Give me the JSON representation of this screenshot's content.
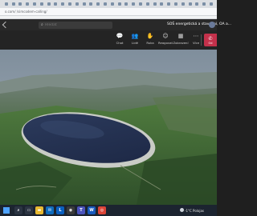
{
  "browser": {
    "url": "o.com/ /simcodem-calling/",
    "tab_count": 32
  },
  "teams": {
    "search_placeholder": "Hledat",
    "meeting_title": "SOŠ energetická a stavební, OA a..."
  },
  "toolbar": {
    "items": [
      {
        "label": "Chat",
        "icon": "chat-icon",
        "glyph": "💬"
      },
      {
        "label": "Lidé",
        "icon": "people-icon",
        "glyph": "👥"
      },
      {
        "label": "Ruka",
        "icon": "raise-hand-icon",
        "glyph": "✋"
      },
      {
        "label": "Reagovat",
        "icon": "react-icon",
        "glyph": "☺"
      },
      {
        "label": "Zobrazení",
        "icon": "view-icon",
        "glyph": "▦"
      },
      {
        "label": "Více",
        "icon": "more-icon",
        "glyph": "⋯"
      }
    ],
    "leave_label": "Od"
  },
  "taskbar": {
    "apps": [
      {
        "name": "search",
        "color": "#2b3442",
        "glyph": "⌕"
      },
      {
        "name": "task-view",
        "color": "#2b3442",
        "glyph": "▭"
      },
      {
        "name": "file-explorer",
        "color": "#e8b931",
        "glyph": "▬"
      },
      {
        "name": "mail",
        "color": "#0f6cbd",
        "glyph": "✉"
      },
      {
        "name": "lenovo",
        "color": "#0a5fbf",
        "glyph": "L"
      },
      {
        "name": "app-camera",
        "color": "#3a3a3a",
        "glyph": "◉"
      },
      {
        "name": "teams",
        "color": "#4b53bc",
        "glyph": "T"
      },
      {
        "name": "word",
        "color": "#185abd",
        "glyph": "W"
      },
      {
        "name": "chrome",
        "color": "#db4437",
        "glyph": "◎"
      }
    ],
    "weather": "-1°C Polojas"
  },
  "colors": {
    "leave": "#c4314b",
    "header": "#292929",
    "toolbar": "#242424",
    "taskbar": "#1c2430"
  }
}
